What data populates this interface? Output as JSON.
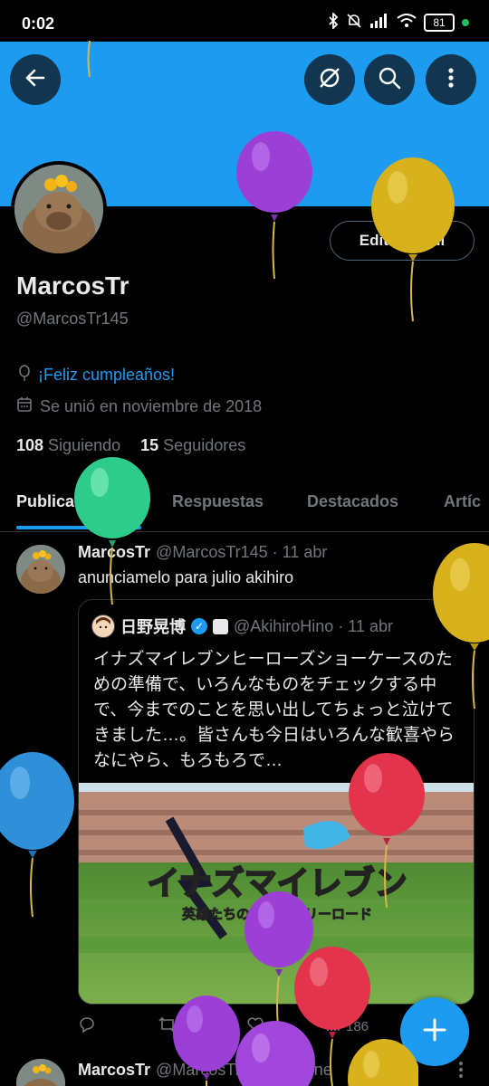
{
  "status_bar": {
    "time": "0:02",
    "battery": "81"
  },
  "header": {
    "back": "back-arrow-icon",
    "actions": [
      "hide-icon",
      "search-icon",
      "more-icon"
    ]
  },
  "profile": {
    "name": "MarcosTr",
    "handle": "@MarcosTr145",
    "edit_label": "Editar perfil",
    "birthday": "¡Feliz cumpleaños!",
    "joined": "Se unió en noviembre de 2018",
    "following_count": "108",
    "following_label": "Siguiendo",
    "followers_count": "15",
    "followers_label": "Seguidores"
  },
  "tabs": [
    "Publicaciones",
    "Respuestas",
    "Destacados",
    "Artíc"
  ],
  "tweet": {
    "name": "MarcosTr",
    "handle_date": "@MarcosTr145 · 11 abr",
    "text": "anunciamelo para julio akihiro",
    "quote": {
      "name": "日野晃博",
      "handle_date": "@AkihiroHino · 11 abr",
      "text": "イナズマイレブンヒーローズショーケースのための準備で、いろんなものをチェックする中で、今までのことを思い出してちょっと泣けてきました…。皆さんも今日はいろんな歓喜やらなにやら、もろもろで…",
      "media_title": "イナズマイレブン",
      "media_subtitle": "英雄たちのヴィクトリーロード"
    },
    "views": "186"
  },
  "tweet2": {
    "name": "MarcosTr",
    "handle_date": "@MarcosTr145 · 30 ene"
  },
  "colors": {
    "accent": "#1d9bf0",
    "bg": "#000000",
    "muted": "#71767b"
  }
}
